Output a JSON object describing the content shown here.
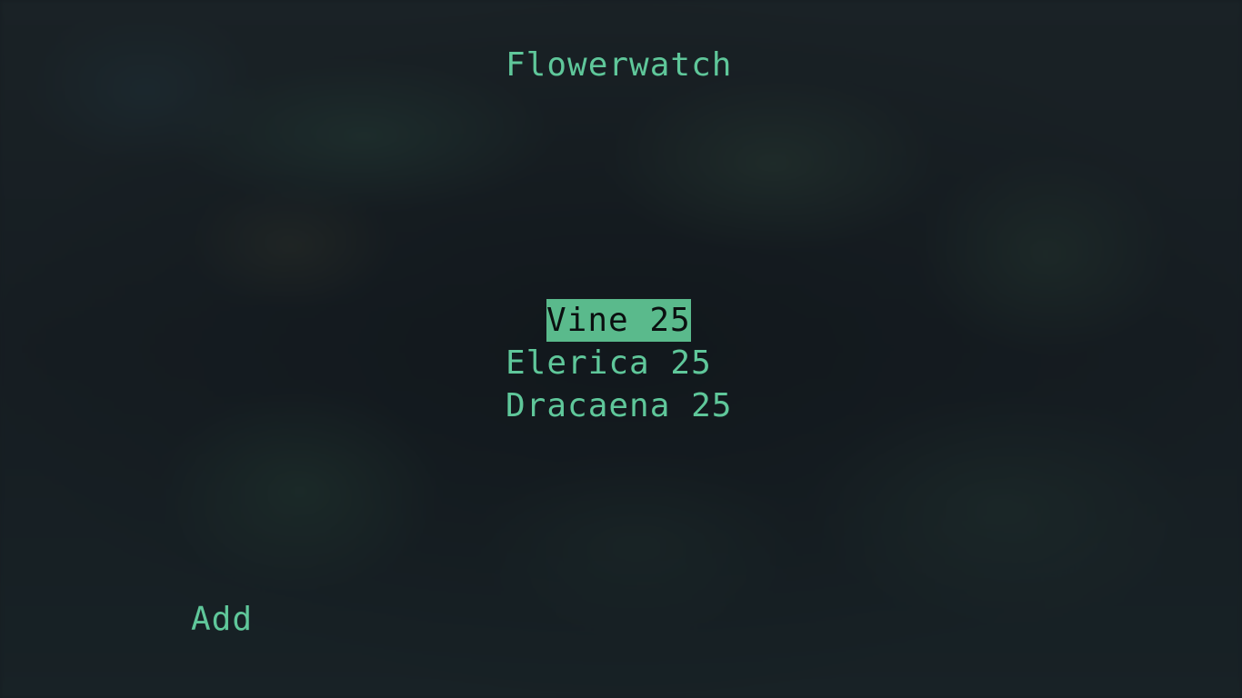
{
  "app": {
    "title": "Flowerwatch"
  },
  "plants": [
    {
      "label": "Vine 25",
      "selected": true
    },
    {
      "label": "Elerica 25",
      "selected": false
    },
    {
      "label": "Dracaena 25",
      "selected": false
    }
  ],
  "actions": {
    "add_label": "Add"
  },
  "colors": {
    "accent": "#5fc79a",
    "selection_bg": "#5aba8c",
    "background": "#161d22"
  }
}
